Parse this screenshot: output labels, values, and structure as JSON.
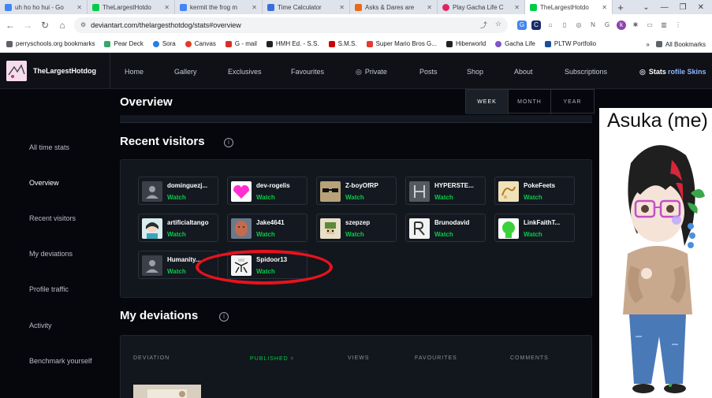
{
  "browser": {
    "tabs": [
      {
        "title": "uh ho ho hui - Go",
        "icon": "google-icon",
        "color": "#4285f4",
        "active": false
      },
      {
        "title": "TheLargestHotdo",
        "icon": "deviantart-icon",
        "color": "#05cc47",
        "active": false
      },
      {
        "title": "kermit the frog m",
        "icon": "google-icon",
        "color": "#4285f4",
        "active": false
      },
      {
        "title": "Time Calculator",
        "icon": "calculator-icon",
        "color": "#3a6fd8",
        "active": false
      },
      {
        "title": "Asks & Dares are",
        "icon": "page-icon",
        "color": "#e66b1b",
        "active": false
      },
      {
        "title": "Play Gacha Life C",
        "icon": "game-icon",
        "color": "#e0245e",
        "active": false
      },
      {
        "title": "TheLargestHotdo",
        "icon": "deviantart-icon",
        "color": "#05cc47",
        "active": true
      }
    ],
    "new_tab": "+",
    "window_controls": [
      "⌄",
      "—",
      "❐",
      "✕"
    ],
    "url": "deviantart.com/thelargesthotdog/stats#overview",
    "bookmarks": [
      {
        "label": "perryschools.org bookmarks",
        "color": "#5f6368"
      },
      {
        "label": "Pear Deck",
        "color": "#3aa56b"
      },
      {
        "label": "Sora",
        "color": "#2c7be5"
      },
      {
        "label": "Canvas",
        "color": "#e13c28"
      },
      {
        "label": "G - mail",
        "color": "#d93025"
      },
      {
        "label": "HMH Ed. - S.S.",
        "color": "#222222"
      },
      {
        "label": "S.M.S.",
        "color": "#cc0000"
      },
      {
        "label": "Super Mario Bros G...",
        "color": "#e33b2e"
      },
      {
        "label": "Hiberworld",
        "color": "#222222"
      },
      {
        "label": "Gacha Life",
        "color": "#7e57c2"
      },
      {
        "label": "PLTW Portfolio",
        "color": "#1a4f9c"
      }
    ],
    "more_bookmarks": "»",
    "all_bookmarks": "All Bookmarks"
  },
  "header": {
    "username": "TheLargestHotdog",
    "nav": [
      {
        "label": "Home",
        "icon": ""
      },
      {
        "label": "Gallery",
        "icon": ""
      },
      {
        "label": "Exclusives",
        "icon": ""
      },
      {
        "label": "Favourites",
        "icon": ""
      },
      {
        "label": "Private",
        "icon": "eye-off-icon"
      },
      {
        "label": "Posts",
        "icon": ""
      },
      {
        "label": "Shop",
        "icon": ""
      },
      {
        "label": "About",
        "icon": ""
      },
      {
        "label": "Subscriptions",
        "icon": ""
      },
      {
        "label": "Stats",
        "icon": "eye-off-icon"
      }
    ],
    "profile_skins": "rofile Skins"
  },
  "sidebar": {
    "items": [
      {
        "label": "All time stats",
        "active": false
      },
      {
        "label": "Overview",
        "active": true
      },
      {
        "label": "Recent visitors",
        "active": false
      },
      {
        "label": "My deviations",
        "active": false
      },
      {
        "label": "Profile traffic",
        "active": false
      },
      {
        "label": "Activity",
        "active": false
      },
      {
        "label": "Benchmark yourself",
        "active": false
      }
    ]
  },
  "overview": {
    "title": "Overview",
    "periods": [
      {
        "label": "WEEK",
        "active": true
      },
      {
        "label": "MONTH",
        "active": false
      },
      {
        "label": "YEAR",
        "active": false
      }
    ]
  },
  "recent_visitors": {
    "title": "Recent visitors",
    "watch_label": "Watch",
    "visitors": [
      {
        "name": "dominguezj...",
        "avatar": "default",
        "color": "#4a4f58"
      },
      {
        "name": "dev-rogelis",
        "avatar": "heart",
        "color": "#ff33cc"
      },
      {
        "name": "Z-boyOfRP",
        "avatar": "sunglasses",
        "color": "#8a7a5a"
      },
      {
        "name": "HYPERSTE...",
        "avatar": "letter",
        "color": "#6b6f76"
      },
      {
        "name": "PokeFeets",
        "avatar": "sketch",
        "color": "#d9b64e"
      },
      {
        "name": "artificialtango",
        "avatar": "anime",
        "color": "#3da5b8"
      },
      {
        "name": "Jake4641",
        "avatar": "photo",
        "color": "#c0604a"
      },
      {
        "name": "szepzep",
        "avatar": "pixel",
        "color": "#5c8a3a"
      },
      {
        "name": "Brunodavid",
        "avatar": "logo",
        "color": "#e6e6e6"
      },
      {
        "name": "LinkFaithT...",
        "avatar": "green",
        "color": "#3bd13b"
      },
      {
        "name": "Humanity...",
        "avatar": "default",
        "color": "#4a4f58"
      },
      {
        "name": "Spidoor13",
        "avatar": "drawing",
        "color": "#f2f2f2"
      }
    ]
  },
  "my_deviations": {
    "title": "My deviations",
    "columns": [
      {
        "label": "DEVIATION",
        "active": false
      },
      {
        "label": "PUBLISHED",
        "active": true
      },
      {
        "label": "VIEWS",
        "active": false
      },
      {
        "label": "FAVOURITES",
        "active": false
      },
      {
        "label": "COMMENTS",
        "active": false
      }
    ]
  },
  "art_panel": {
    "caption": "Asuka (me)"
  },
  "colors": {
    "accent_green": "#05cc47",
    "highlight_red": "#e8121d",
    "page_bg": "#06070d"
  }
}
